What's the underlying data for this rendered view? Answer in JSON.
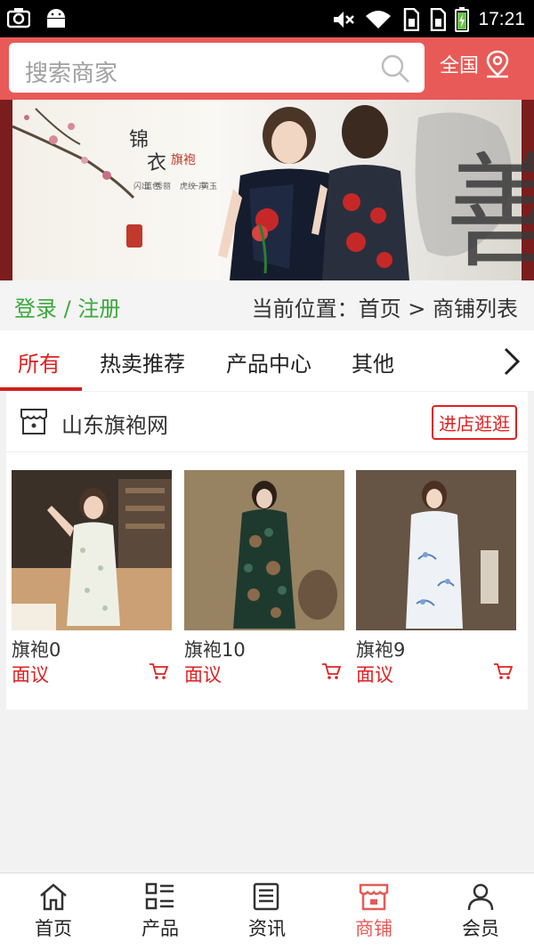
{
  "status_bar": {
    "time": "17:21"
  },
  "search": {
    "placeholder": "搜索商家",
    "region_label": "全国"
  },
  "banner": {
    "brand_text": "锦衣旗袍",
    "calligraphy": "善"
  },
  "login": {
    "link_label": "登录 / 注册"
  },
  "breadcrumb": {
    "text": "当前位置：首页 > 商铺列表"
  },
  "tabs": [
    {
      "label": "所有",
      "active": true
    },
    {
      "label": "热卖推荐",
      "active": false
    },
    {
      "label": "产品中心",
      "active": false
    },
    {
      "label": "其他",
      "active": false
    }
  ],
  "shop": {
    "name": "山东旗袍网",
    "enter_label": "进店逛逛",
    "products": [
      {
        "name": "旗袍0",
        "price": "面议"
      },
      {
        "name": "旗袍10",
        "price": "面议"
      },
      {
        "name": "旗袍9",
        "price": "面议"
      }
    ]
  },
  "bottom_nav": [
    {
      "label": "首页",
      "icon": "home-icon",
      "active": false
    },
    {
      "label": "产品",
      "icon": "grid-list-icon",
      "active": false
    },
    {
      "label": "资讯",
      "icon": "news-icon",
      "active": false
    },
    {
      "label": "商铺",
      "icon": "store-icon",
      "active": true
    },
    {
      "label": "会员",
      "icon": "user-icon",
      "active": false
    }
  ],
  "colors": {
    "accent": "#e85a57",
    "price": "#e02020",
    "login_green": "#3aa93a"
  }
}
